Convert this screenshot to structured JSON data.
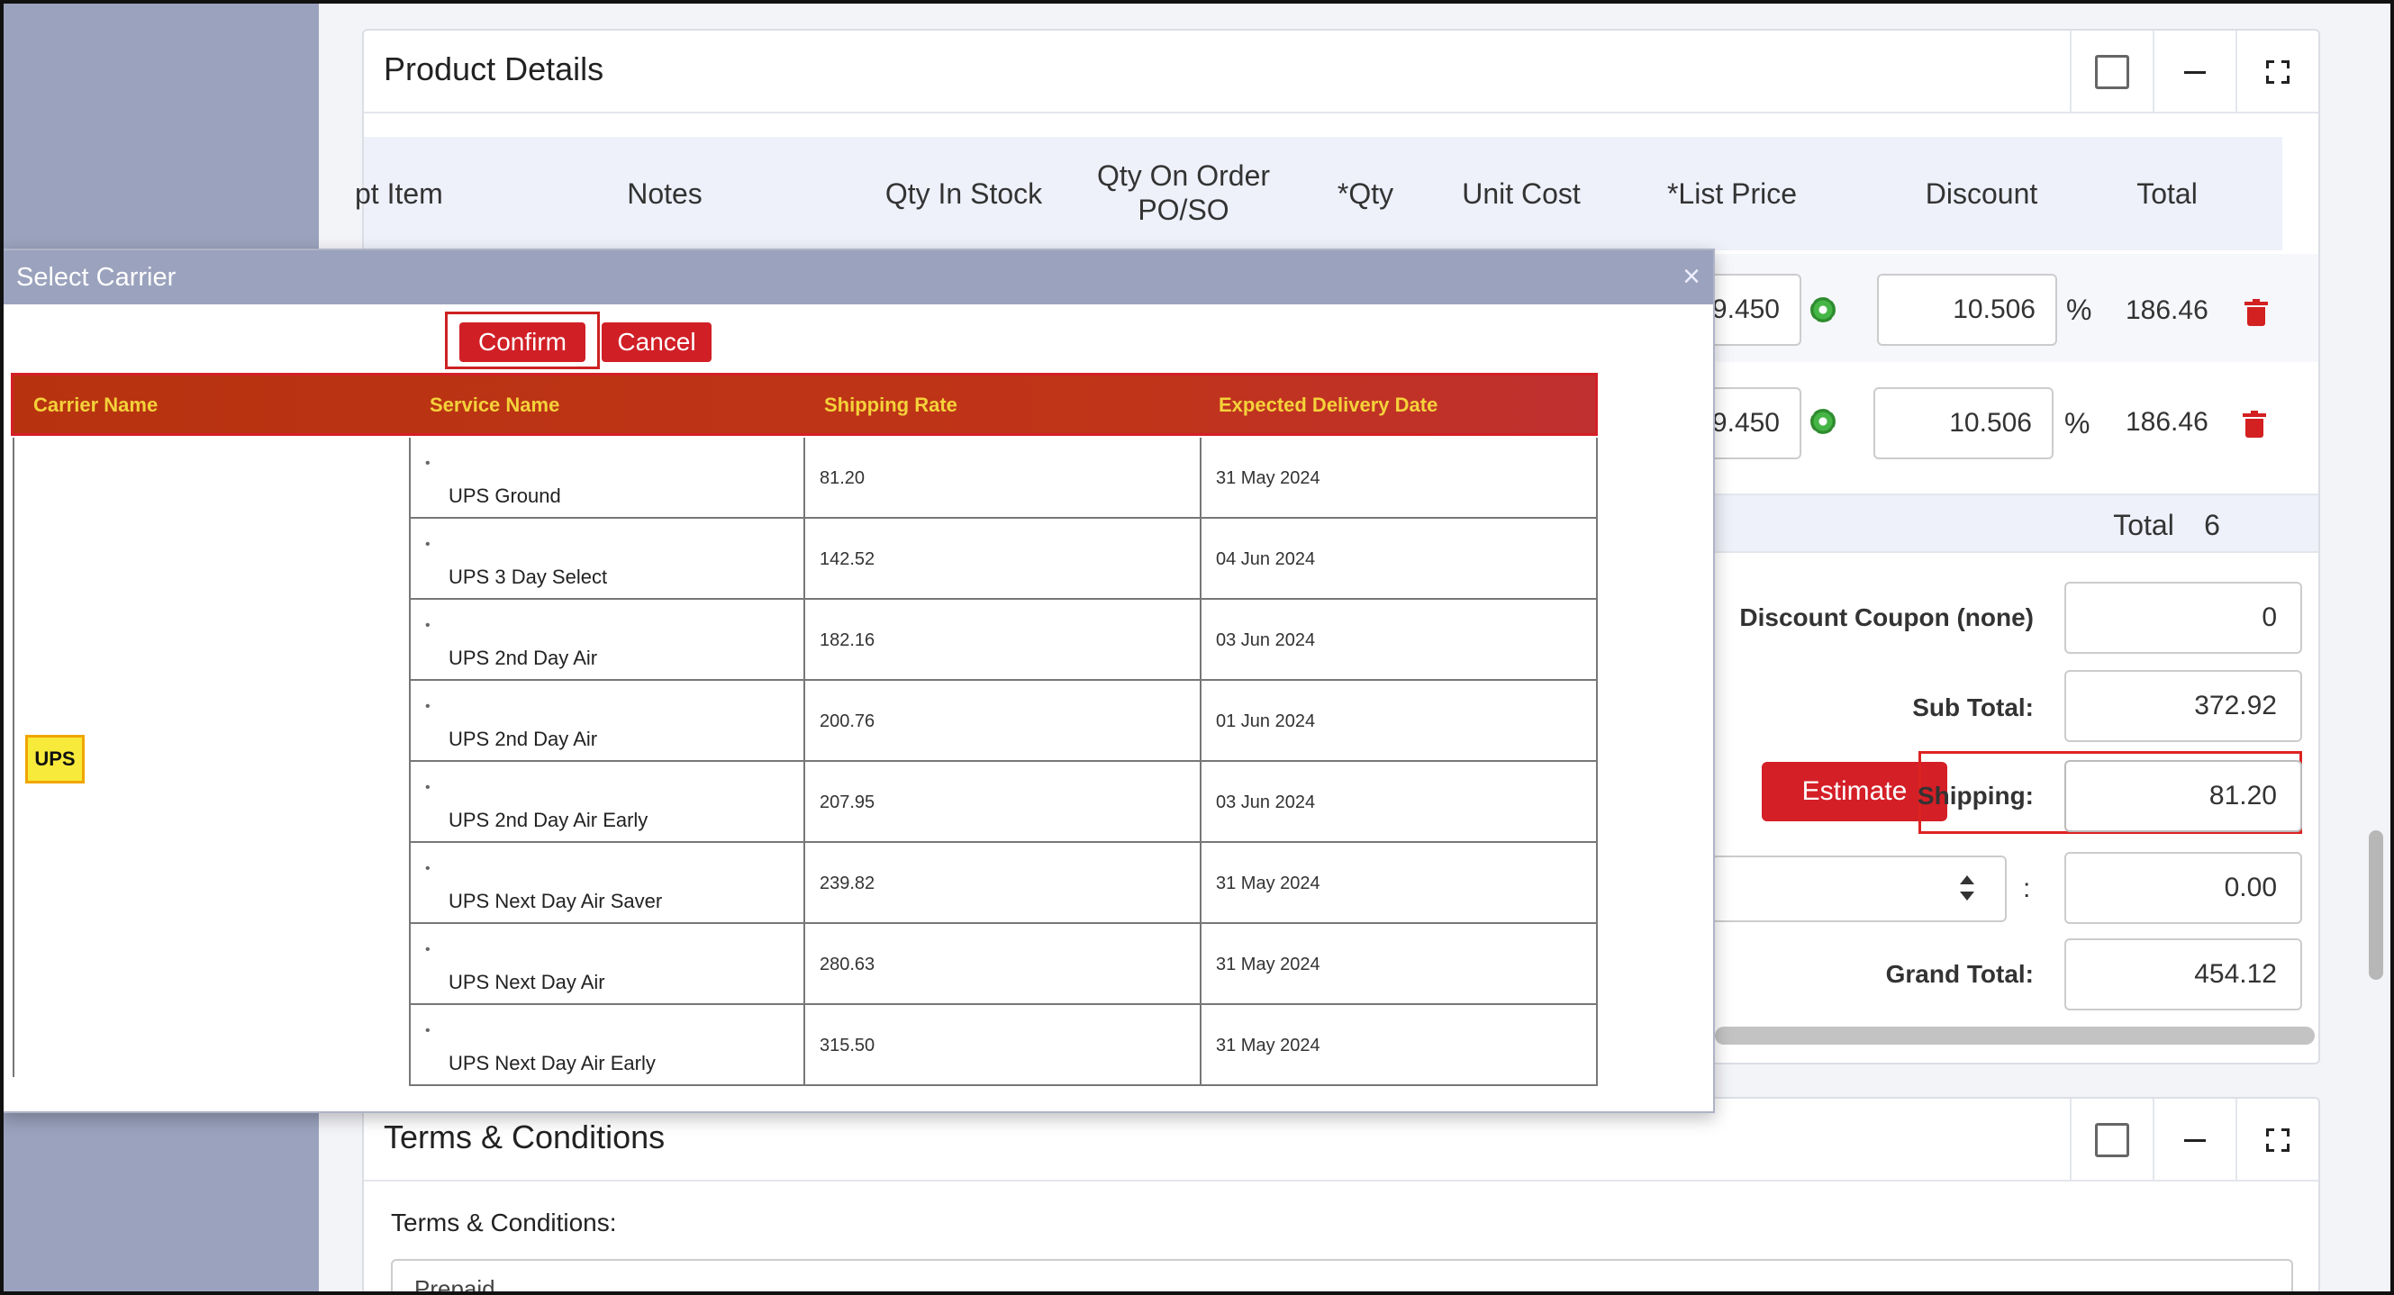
{
  "product_details": {
    "title": "Product Details",
    "columns": [
      "pt Item",
      "Notes",
      "Qty In Stock",
      "Qty On Order\nPO/SO",
      "*Qty",
      "Unit Cost",
      "*List Price",
      "Discount",
      "Total"
    ],
    "rows": [
      {
        "list_price": "9.450",
        "discount": "10.506",
        "pct": "%",
        "total": "186.46"
      },
      {
        "list_price": "9.450",
        "discount": "10.506",
        "pct": "%",
        "total": "186.46"
      }
    ],
    "total_label": "Total",
    "total_value": "6",
    "summary": {
      "discount_label": "Discount Coupon (none)",
      "discount_value": "0",
      "subtotal_label": "Sub Total:",
      "subtotal_value": "372.92",
      "estimate_label": "Estimate",
      "shipping_label": "Shipping:",
      "shipping_value": "81.20",
      "tax_colon": ":",
      "tax_value": "0.00",
      "grand_label": "Grand Total:",
      "grand_value": "454.12"
    }
  },
  "terms": {
    "title": "Terms & Conditions",
    "label": "Terms & Conditions:",
    "value": "Prepaid"
  },
  "modal": {
    "title": "Select Carrier",
    "close": "×",
    "confirm": "Confirm",
    "cancel": "Cancel",
    "headers": [
      "Carrier Name",
      "Service Name",
      "Shipping Rate",
      "Expected Delivery Date"
    ],
    "carrier": "UPS",
    "services": [
      {
        "name": "UPS Ground",
        "rate": "81.20",
        "date": "31 May 2024"
      },
      {
        "name": "UPS 3 Day Select",
        "rate": "142.52",
        "date": "04 Jun 2024"
      },
      {
        "name": "UPS 2nd Day Air",
        "rate": "182.16",
        "date": "03 Jun 2024"
      },
      {
        "name": "UPS 2nd Day Air",
        "rate": "200.76",
        "date": "01 Jun 2024"
      },
      {
        "name": "UPS 2nd Day Air Early",
        "rate": "207.95",
        "date": "03 Jun 2024"
      },
      {
        "name": "UPS Next Day Air Saver",
        "rate": "239.82",
        "date": "31 May 2024"
      },
      {
        "name": "UPS Next Day Air",
        "rate": "280.63",
        "date": "31 May 2024"
      },
      {
        "name": "UPS Next Day Air Early",
        "rate": "315.50",
        "date": "31 May 2024"
      }
    ],
    "bullet": "•"
  },
  "colors": {
    "accent_red": "#d41f26",
    "header_brown": "#b93012",
    "header_text": "#f4d23a",
    "rail": "#9aa2bd"
  }
}
